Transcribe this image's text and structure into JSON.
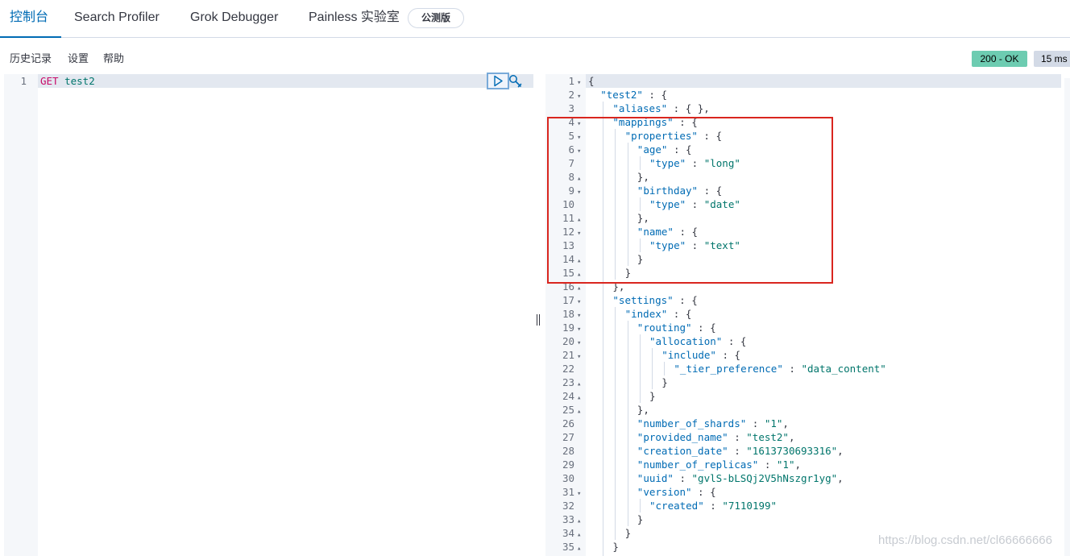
{
  "tabs": [
    {
      "label": "控制台"
    },
    {
      "label": "Search Profiler"
    },
    {
      "label": "Grok Debugger"
    },
    {
      "label": "Painless 实验室"
    }
  ],
  "beta_badge": "公测版",
  "subnav": {
    "history": "历史记录",
    "settings": "设置",
    "help": "帮助"
  },
  "status": {
    "code": "200 - OK",
    "time": "15 ms"
  },
  "request": {
    "line_number": "1",
    "method": "GET",
    "url": "test2"
  },
  "icons": {
    "play": "play-icon",
    "wrench": "wrench-icon"
  },
  "response": {
    "lines": [
      {
        "n": "1",
        "fold": "open",
        "depth": 0,
        "tokens": [
          {
            "t": "p",
            "v": "{"
          }
        ]
      },
      {
        "n": "2",
        "fold": "open",
        "depth": 1,
        "tokens": [
          {
            "t": "k",
            "v": "\"test2\""
          },
          {
            "t": "p",
            "v": " : {"
          }
        ]
      },
      {
        "n": "3",
        "fold": "",
        "depth": 2,
        "tokens": [
          {
            "t": "k",
            "v": "\"aliases\""
          },
          {
            "t": "p",
            "v": " : { },"
          }
        ]
      },
      {
        "n": "4",
        "fold": "open",
        "depth": 2,
        "tokens": [
          {
            "t": "k",
            "v": "\"mappings\""
          },
          {
            "t": "p",
            "v": " : {"
          }
        ]
      },
      {
        "n": "5",
        "fold": "open",
        "depth": 3,
        "tokens": [
          {
            "t": "k",
            "v": "\"properties\""
          },
          {
            "t": "p",
            "v": " : {"
          }
        ]
      },
      {
        "n": "6",
        "fold": "open",
        "depth": 4,
        "tokens": [
          {
            "t": "k",
            "v": "\"age\""
          },
          {
            "t": "p",
            "v": " : {"
          }
        ]
      },
      {
        "n": "7",
        "fold": "",
        "depth": 5,
        "tokens": [
          {
            "t": "k",
            "v": "\"type\""
          },
          {
            "t": "p",
            "v": " : "
          },
          {
            "t": "s",
            "v": "\"long\""
          }
        ]
      },
      {
        "n": "8",
        "fold": "close",
        "depth": 4,
        "tokens": [
          {
            "t": "p",
            "v": "},"
          }
        ]
      },
      {
        "n": "9",
        "fold": "open",
        "depth": 4,
        "tokens": [
          {
            "t": "k",
            "v": "\"birthday\""
          },
          {
            "t": "p",
            "v": " : {"
          }
        ]
      },
      {
        "n": "10",
        "fold": "",
        "depth": 5,
        "tokens": [
          {
            "t": "k",
            "v": "\"type\""
          },
          {
            "t": "p",
            "v": " : "
          },
          {
            "t": "s",
            "v": "\"date\""
          }
        ]
      },
      {
        "n": "11",
        "fold": "close",
        "depth": 4,
        "tokens": [
          {
            "t": "p",
            "v": "},"
          }
        ]
      },
      {
        "n": "12",
        "fold": "open",
        "depth": 4,
        "tokens": [
          {
            "t": "k",
            "v": "\"name\""
          },
          {
            "t": "p",
            "v": " : {"
          }
        ]
      },
      {
        "n": "13",
        "fold": "",
        "depth": 5,
        "tokens": [
          {
            "t": "k",
            "v": "\"type\""
          },
          {
            "t": "p",
            "v": " : "
          },
          {
            "t": "s",
            "v": "\"text\""
          }
        ]
      },
      {
        "n": "14",
        "fold": "close",
        "depth": 4,
        "tokens": [
          {
            "t": "p",
            "v": "}"
          }
        ]
      },
      {
        "n": "15",
        "fold": "close",
        "depth": 3,
        "tokens": [
          {
            "t": "p",
            "v": "}"
          }
        ]
      },
      {
        "n": "16",
        "fold": "close",
        "depth": 2,
        "tokens": [
          {
            "t": "p",
            "v": "},"
          }
        ]
      },
      {
        "n": "17",
        "fold": "open",
        "depth": 2,
        "tokens": [
          {
            "t": "k",
            "v": "\"settings\""
          },
          {
            "t": "p",
            "v": " : {"
          }
        ]
      },
      {
        "n": "18",
        "fold": "open",
        "depth": 3,
        "tokens": [
          {
            "t": "k",
            "v": "\"index\""
          },
          {
            "t": "p",
            "v": " : {"
          }
        ]
      },
      {
        "n": "19",
        "fold": "open",
        "depth": 4,
        "tokens": [
          {
            "t": "k",
            "v": "\"routing\""
          },
          {
            "t": "p",
            "v": " : {"
          }
        ]
      },
      {
        "n": "20",
        "fold": "open",
        "depth": 5,
        "tokens": [
          {
            "t": "k",
            "v": "\"allocation\""
          },
          {
            "t": "p",
            "v": " : {"
          }
        ]
      },
      {
        "n": "21",
        "fold": "open",
        "depth": 6,
        "tokens": [
          {
            "t": "k",
            "v": "\"include\""
          },
          {
            "t": "p",
            "v": " : {"
          }
        ]
      },
      {
        "n": "22",
        "fold": "",
        "depth": 7,
        "tokens": [
          {
            "t": "k",
            "v": "\"_tier_preference\""
          },
          {
            "t": "p",
            "v": " : "
          },
          {
            "t": "s",
            "v": "\"data_content\""
          }
        ]
      },
      {
        "n": "23",
        "fold": "close",
        "depth": 6,
        "tokens": [
          {
            "t": "p",
            "v": "}"
          }
        ]
      },
      {
        "n": "24",
        "fold": "close",
        "depth": 5,
        "tokens": [
          {
            "t": "p",
            "v": "}"
          }
        ]
      },
      {
        "n": "25",
        "fold": "close",
        "depth": 4,
        "tokens": [
          {
            "t": "p",
            "v": "},"
          }
        ]
      },
      {
        "n": "26",
        "fold": "",
        "depth": 4,
        "tokens": [
          {
            "t": "k",
            "v": "\"number_of_shards\""
          },
          {
            "t": "p",
            "v": " : "
          },
          {
            "t": "s",
            "v": "\"1\""
          },
          {
            "t": "p",
            "v": ","
          }
        ]
      },
      {
        "n": "27",
        "fold": "",
        "depth": 4,
        "tokens": [
          {
            "t": "k",
            "v": "\"provided_name\""
          },
          {
            "t": "p",
            "v": " : "
          },
          {
            "t": "s",
            "v": "\"test2\""
          },
          {
            "t": "p",
            "v": ","
          }
        ]
      },
      {
        "n": "28",
        "fold": "",
        "depth": 4,
        "tokens": [
          {
            "t": "k",
            "v": "\"creation_date\""
          },
          {
            "t": "p",
            "v": " : "
          },
          {
            "t": "s",
            "v": "\"1613730693316\""
          },
          {
            "t": "p",
            "v": ","
          }
        ]
      },
      {
        "n": "29",
        "fold": "",
        "depth": 4,
        "tokens": [
          {
            "t": "k",
            "v": "\"number_of_replicas\""
          },
          {
            "t": "p",
            "v": " : "
          },
          {
            "t": "s",
            "v": "\"1\""
          },
          {
            "t": "p",
            "v": ","
          }
        ]
      },
      {
        "n": "30",
        "fold": "",
        "depth": 4,
        "tokens": [
          {
            "t": "k",
            "v": "\"uuid\""
          },
          {
            "t": "p",
            "v": " : "
          },
          {
            "t": "s",
            "v": "\"gvlS-bLSQj2V5hNszgr1yg\""
          },
          {
            "t": "p",
            "v": ","
          }
        ]
      },
      {
        "n": "31",
        "fold": "open",
        "depth": 4,
        "tokens": [
          {
            "t": "k",
            "v": "\"version\""
          },
          {
            "t": "p",
            "v": " : {"
          }
        ]
      },
      {
        "n": "32",
        "fold": "",
        "depth": 5,
        "tokens": [
          {
            "t": "k",
            "v": "\"created\""
          },
          {
            "t": "p",
            "v": " : "
          },
          {
            "t": "s",
            "v": "\"7110199\""
          }
        ]
      },
      {
        "n": "33",
        "fold": "close",
        "depth": 4,
        "tokens": [
          {
            "t": "p",
            "v": "}"
          }
        ]
      },
      {
        "n": "34",
        "fold": "close",
        "depth": 3,
        "tokens": [
          {
            "t": "p",
            "v": "}"
          }
        ]
      },
      {
        "n": "35",
        "fold": "close",
        "depth": 2,
        "tokens": [
          {
            "t": "p",
            "v": "}"
          }
        ]
      }
    ]
  },
  "watermark": "https://blog.csdn.net/cl66666666"
}
